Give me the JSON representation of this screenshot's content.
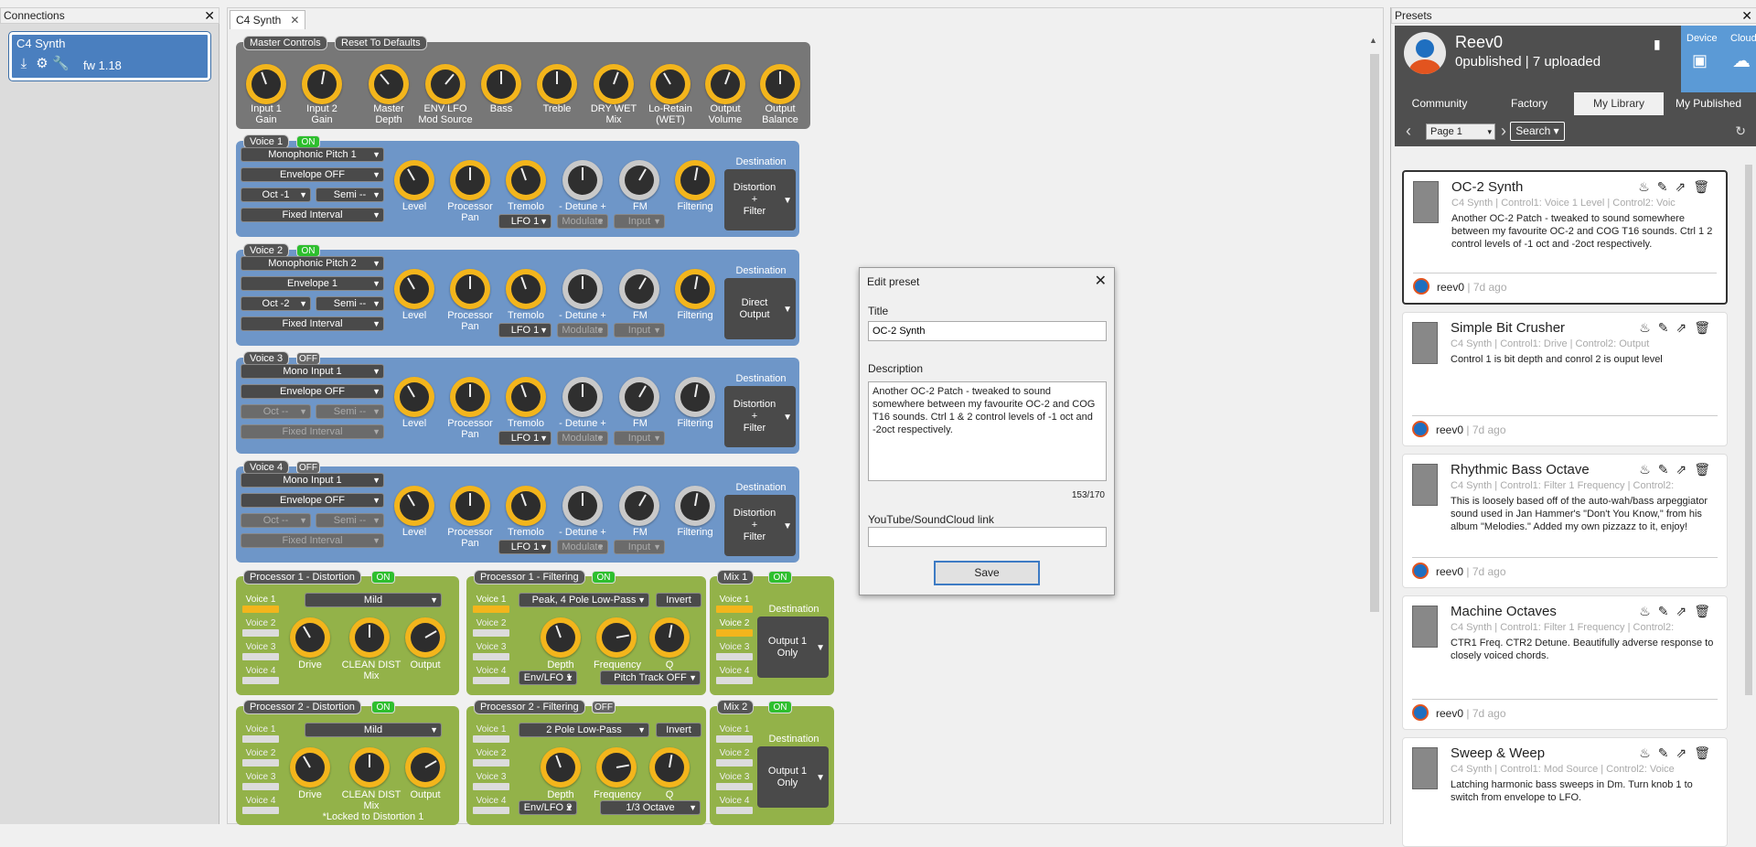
{
  "connections": {
    "title": "Connections",
    "device": {
      "name": "C4 Synth",
      "fw": "fw 1.18"
    }
  },
  "doc": {
    "tab": "C4 Synth",
    "close": "✕"
  },
  "master": {
    "header": "Master Controls",
    "reset": "Reset To Defaults",
    "knobs": [
      {
        "l1": "Input 1",
        "l2": "Gain"
      },
      {
        "l1": "Input 2",
        "l2": "Gain"
      },
      {
        "l1": "Master",
        "l2": "Depth"
      },
      {
        "l1": "ENV      LFO",
        "l2": "Mod Source"
      },
      {
        "l1": "Bass",
        "l2": ""
      },
      {
        "l1": "Treble",
        "l2": ""
      },
      {
        "l1": "DRY     WET",
        "l2": "Mix"
      },
      {
        "l1": "Lo-Retain",
        "l2": "(WET)"
      },
      {
        "l1": "Output",
        "l2": "Volume"
      },
      {
        "l1": "Output",
        "l2": "Balance"
      }
    ]
  },
  "voices": [
    {
      "label": "Voice 1",
      "state": "ON",
      "source": "Monophonic Pitch 1",
      "env": "Envelope OFF",
      "oct": "Oct -1",
      "semi": "Semi --",
      "interval": "Fixed Interval",
      "lfo": "LFO 1",
      "mod": "Modulate",
      "input": "Input",
      "dest": [
        "Distortion",
        "+",
        "Filter"
      ]
    },
    {
      "label": "Voice 2",
      "state": "ON",
      "source": "Monophonic Pitch 2",
      "env": "Envelope 1",
      "oct": "Oct -2",
      "semi": "Semi --",
      "interval": "Fixed Interval",
      "lfo": "LFO 1",
      "mod": "Modulate",
      "input": "Input",
      "dest": [
        "Direct",
        "Output"
      ]
    },
    {
      "label": "Voice 3",
      "state": "OFF",
      "source": "Mono Input 1",
      "env": "Envelope OFF",
      "oct": "Oct --",
      "semi": "Semi --",
      "interval": "Fixed Interval",
      "lfo": "LFO 1",
      "mod": "Modulate",
      "input": "Input",
      "dest": [
        "Distortion",
        "+",
        "Filter"
      ]
    },
    {
      "label": "Voice 4",
      "state": "OFF",
      "source": "Mono Input 1",
      "env": "Envelope OFF",
      "oct": "Oct --",
      "semi": "Semi --",
      "interval": "Fixed Interval",
      "lfo": "LFO 1",
      "mod": "Modulate",
      "input": "Input",
      "dest": [
        "Distortion",
        "+",
        "Filter"
      ]
    }
  ],
  "voice_knobs": {
    "level": "Level",
    "pan1": "Processor",
    "pan2": "Pan",
    "tremolo": "Tremolo",
    "detune": "- Detune +",
    "fm": "FM",
    "filtering": "Filtering",
    "dest": "Destination"
  },
  "voice_list": [
    "Voice 1",
    "Voice 2",
    "Voice 3",
    "Voice 4"
  ],
  "proc1_dist": {
    "label": "Processor 1 - Distortion",
    "state": "ON",
    "mode": "Mild",
    "drive": "Drive",
    "mix1": "CLEAN    DIST",
    "mix2": "Mix",
    "out": "Output"
  },
  "proc1_filt": {
    "label": "Processor 1 - Filtering",
    "state": "ON",
    "type": "Peak, 4 Pole Low-Pass",
    "invert": "Invert",
    "depth": "Depth",
    "freq": "Frequency",
    "q": "Q",
    "src": "Env/LFO 1",
    "track": "Pitch Track OFF"
  },
  "mix1": {
    "label": "Mix 1",
    "state": "ON",
    "dest": "Destination",
    "out": [
      "Output 1",
      "Only"
    ]
  },
  "proc2_dist": {
    "label": "Processor 2 - Distortion",
    "state": "ON",
    "mode": "Mild",
    "drive": "Drive",
    "mix1": "CLEAN    DIST",
    "mix2": "Mix",
    "out": "Output",
    "note": "*Locked to Distortion 1"
  },
  "proc2_filt": {
    "label": "Processor 2 - Filtering",
    "state": "OFF",
    "type": "2 Pole Low-Pass",
    "invert": "Invert",
    "depth": "Depth",
    "freq": "Frequency",
    "q": "Q",
    "src": "Env/LFO 2",
    "track": "1/3 Octave"
  },
  "mix2": {
    "label": "Mix 2",
    "state": "ON",
    "dest": "Destination",
    "out": [
      "Output 1",
      "Only"
    ]
  },
  "dialog": {
    "title": "Edit preset",
    "title_label": "Title",
    "title_value": "OC-2 Synth",
    "desc_label": "Description",
    "desc_value": "Another OC-2 Patch - tweaked to sound somewhere between my favourite OC-2 and COG T16 sounds. Ctrl 1 & 2 control levels of -1 oct and -2oct respectively.",
    "count": "153/170",
    "link_label": "YouTube/SoundCloud link",
    "link_value": "",
    "save": "Save"
  },
  "presets": {
    "title": "Presets",
    "user": "Reev0",
    "published": "0",
    "uploaded": "7",
    "pub_text": "published |",
    "up_text": "uploaded",
    "device": "Device",
    "cloud": "Cloud",
    "tabs": [
      "Community",
      "Factory",
      "My Library",
      "My Published"
    ],
    "page": "Page 1",
    "search": "Search",
    "cards": [
      {
        "title": "OC-2 Synth",
        "sub": "C4 Synth | Control1: Voice 1 Level | Control2: Voic",
        "desc": "Another OC-2 Patch - tweaked to sound somewhere between my favourite OC-2 and COG T16 sounds. Ctrl 1  2 control levels of -1 oct and -2oct respectively.",
        "user": "reev0",
        "age": "| 7d ago"
      },
      {
        "title": "Simple Bit Crusher",
        "sub": "C4 Synth | Control1: Drive | Control2: Output",
        "desc": "Control 1 is bit depth and conrol 2 is ouput level",
        "user": "reev0",
        "age": "| 7d ago"
      },
      {
        "title": "Rhythmic Bass Octave",
        "sub": "C4 Synth | Control1: Filter 1 Frequency | Control2:",
        "desc": "This is loosely based off of the auto-wah/bass arpeggiator sound used in Jan Hammer's \"Don't You Know,\" from his album \"Melodies.\" Added my own pizzazz to it, enjoy!",
        "user": "reev0",
        "age": "| 7d ago"
      },
      {
        "title": "Machine Octaves",
        "sub": "C4 Synth | Control1: Filter 1 Frequency | Control2:",
        "desc": "CTR1 Freq. CTR2 Detune. Beautifully adverse response to closely voiced chords.",
        "user": "reev0",
        "age": "| 7d ago"
      },
      {
        "title": "Sweep & Weep",
        "sub": "C4 Synth | Control1: Mod Source | Control2: Voice",
        "desc": "Latching harmonic bass sweeps in Dm. Turn knob 1 to switch from envelope to LFO.",
        "user": "",
        "age": ""
      }
    ]
  }
}
